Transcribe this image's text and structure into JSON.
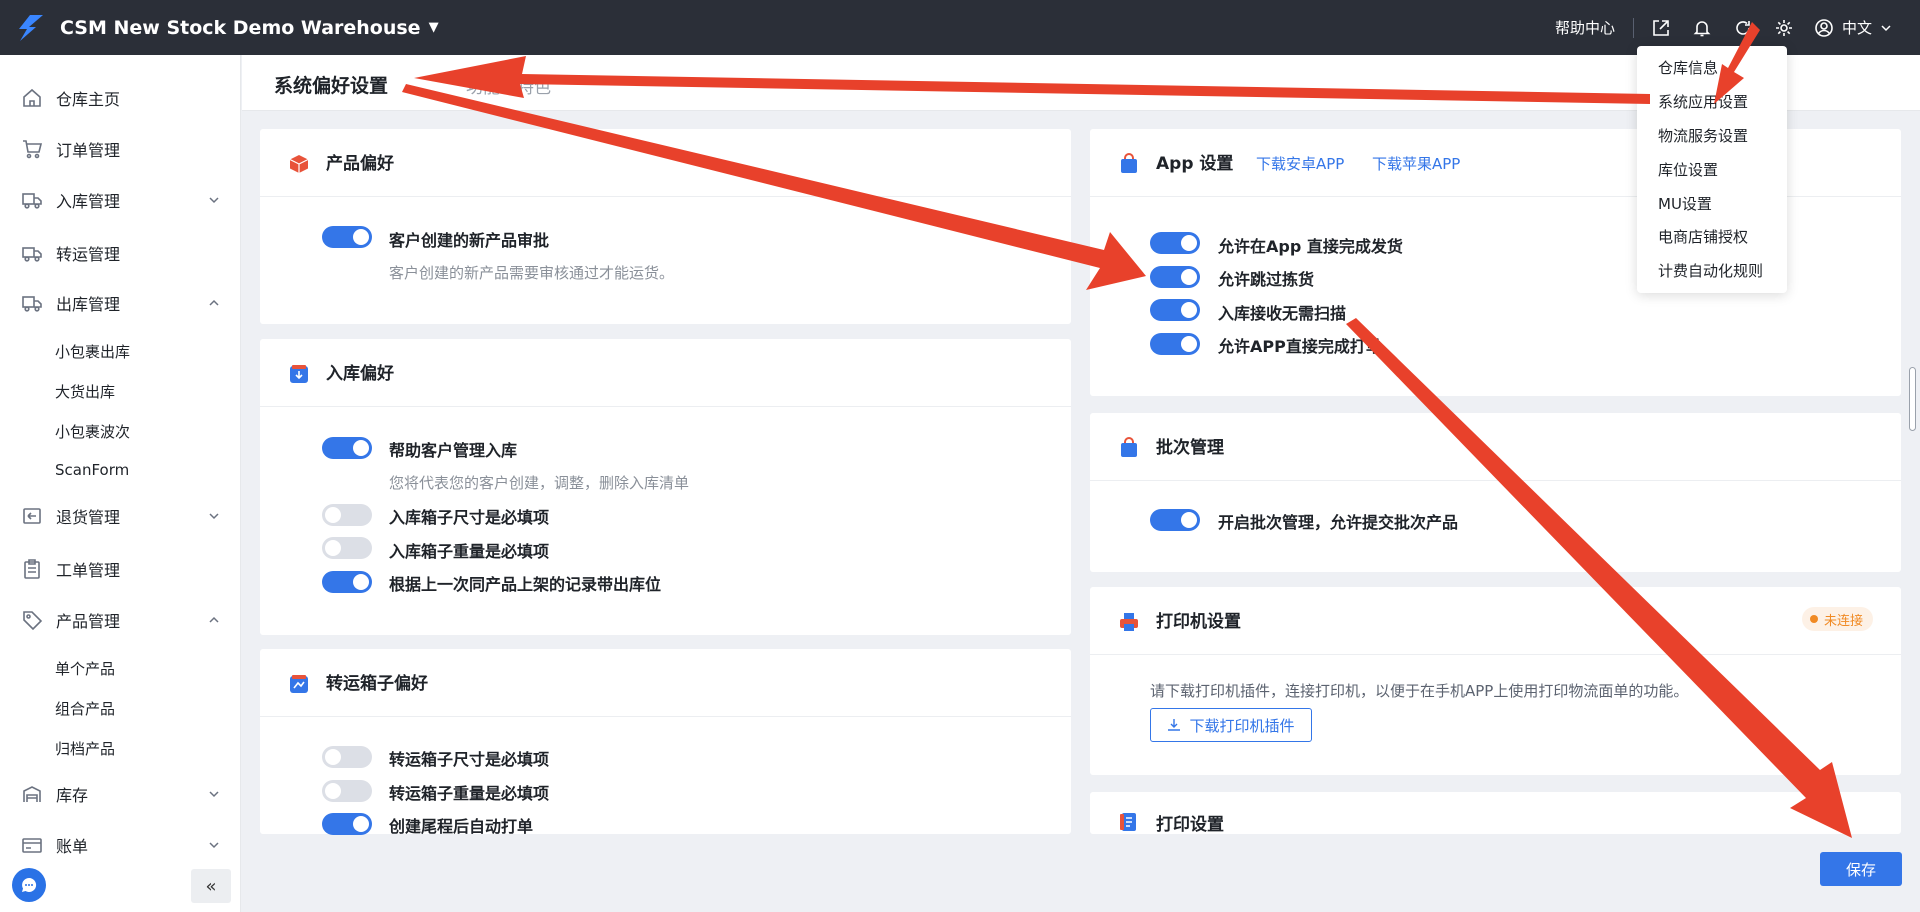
{
  "app": {
    "title": "CSM New Stock Demo Warehouse"
  },
  "topbar": {
    "help": "帮助中心",
    "lang": "中文"
  },
  "sidebar": {
    "home": "仓库主页",
    "orders": "订单管理",
    "inbound": "入库管理",
    "transfer": "转运管理",
    "outbound": "出库管理",
    "outbound_sub": [
      "小包裹出库",
      "大货出库",
      "小包裹波次",
      "ScanForm"
    ],
    "returns": "退货管理",
    "tickets": "工单管理",
    "products": "产品管理",
    "products_sub": [
      "单个产品",
      "组合产品",
      "归档产品"
    ],
    "inventory": "库存",
    "billing": "账单"
  },
  "page": {
    "title": "系统偏好设置",
    "tab2": "功能与特色"
  },
  "product_pref": {
    "title": "产品偏好",
    "opt1_label": "客户创建的新产品审批",
    "opt1_desc": "客户创建的新产品需要审核通过才能运货。"
  },
  "inbound_pref": {
    "title": "入库偏好",
    "opt1_label": "帮助客户管理入库",
    "opt1_desc": "您将代表您的客户创建，调整，删除入库清单",
    "opt2_label": "入库箱子尺寸是必填项",
    "opt3_label": "入库箱子重量是必填项",
    "opt4_label": "根据上一次同产品上架的记录带出库位"
  },
  "transfer_pref": {
    "title": "转运箱子偏好",
    "opt1_label": "转运箱子尺寸是必填项",
    "opt2_label": "转运箱子重量是必填项",
    "opt3_label": "创建尾程后自动打单"
  },
  "app_settings": {
    "title": "App 设置",
    "android": "下载安卓APP",
    "ios": "下载苹果APP",
    "opt1": "允许在App 直接完成发货",
    "opt2": "允许跳过拣货",
    "opt3": "入库接收无需扫描",
    "opt4": "允许APP直接完成打单"
  },
  "batch": {
    "title": "批次管理",
    "opt1": "开启批次管理，允许提交批次产品"
  },
  "printer": {
    "title": "打印机设置",
    "status": "未连接",
    "desc": "请下载打印机插件，连接打印机，以便于在手机APP上使用打印物流面单的功能。",
    "download": "下载打印机插件"
  },
  "print_settings": {
    "title": "打印设置"
  },
  "dropdown": {
    "items": [
      "仓库信息",
      "系统应用设置",
      "物流服务设置",
      "库位设置",
      "MU设置",
      "电商店铺授权",
      "计费自动化规则"
    ]
  },
  "actions": {
    "save": "保存"
  },
  "colors": {
    "primary": "#3476e8",
    "topbar": "#2b2f38",
    "annotation": "#e8412b",
    "warning": "#f08a24"
  }
}
